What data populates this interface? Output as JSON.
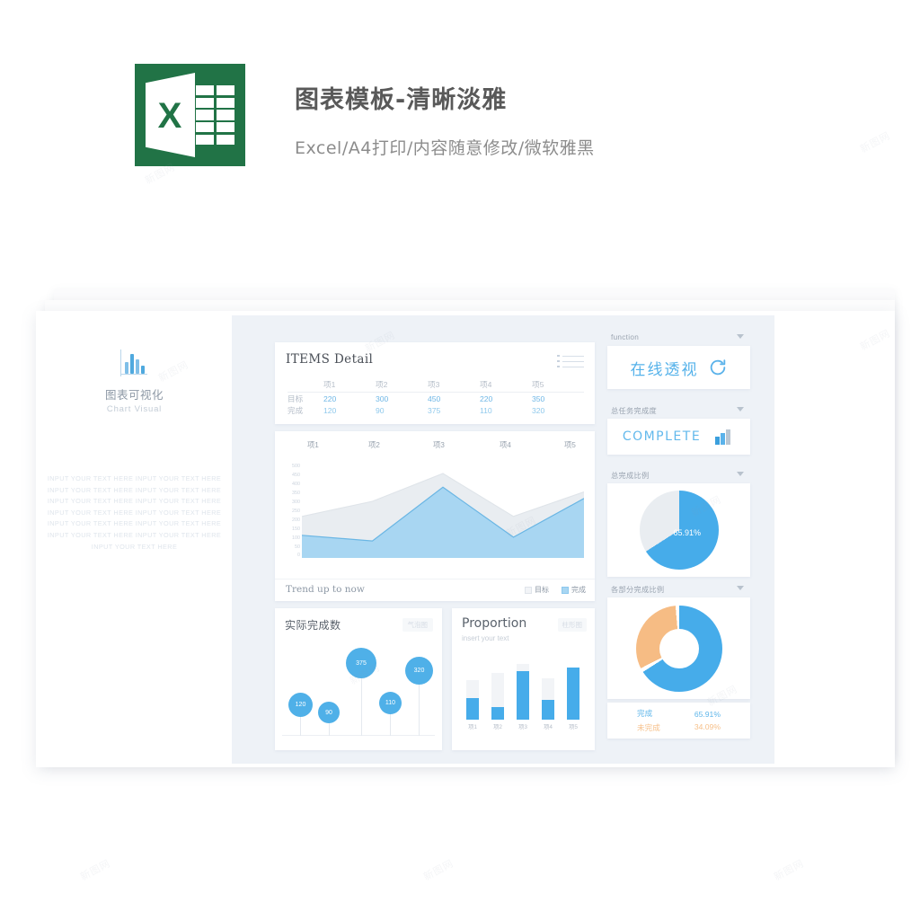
{
  "header": {
    "logo_letter": "X",
    "title": "图表模板-清晰淡雅",
    "subtitle": "Excel/A4打印/内容随意修改/微软雅黑"
  },
  "sidebar_left": {
    "brand_cn": "图表可视化",
    "brand_en": "Chart Visual",
    "filler_text": "INPUT YOUR TEXT HERE INPUT YOUR TEXT HERE INPUT YOUR TEXT HERE INPUT YOUR TEXT HERE INPUT YOUR TEXT HERE INPUT YOUR TEXT HERE INPUT YOUR TEXT HERE INPUT YOUR TEXT HERE INPUT YOUR TEXT HERE INPUT YOUR TEXT HERE INPUT YOUR TEXT HERE INPUT YOUR TEXT HERE INPUT YOUR TEXT HERE"
  },
  "items_detail": {
    "title": "ITEMS Detail",
    "menu_icon": "list-icon",
    "columns": [
      "",
      "项1",
      "项2",
      "项3",
      "项4",
      "项5"
    ],
    "rows": [
      {
        "label": "目标",
        "values": [
          "220",
          "300",
          "450",
          "220",
          "350"
        ]
      },
      {
        "label": "完成",
        "values": [
          "120",
          "90",
          "375",
          "110",
          "320"
        ]
      }
    ]
  },
  "area_chart": {
    "footer_label": "Trend up to now",
    "legend": [
      "目标",
      "完成"
    ],
    "top_labels": [
      "项1",
      "项2",
      "项3",
      "项4",
      "项5"
    ],
    "y_ticks": [
      "500",
      "450",
      "400",
      "350",
      "300",
      "250",
      "200",
      "150",
      "100",
      "50",
      "0"
    ]
  },
  "bubble_chart": {
    "title": "实际完成数",
    "badge": "气泡图",
    "values": [
      "120",
      "90",
      "375",
      "110",
      "320"
    ]
  },
  "proportion": {
    "title": "Proportion",
    "subtitle": "insert your text",
    "badge": "柱形图",
    "categories": [
      "项1",
      "项2",
      "项3",
      "项4",
      "项5"
    ]
  },
  "sidebar_right": {
    "function_panel": {
      "header": "function",
      "value": "在线透视",
      "icon": "refresh-icon"
    },
    "complete_panel": {
      "header": "总任务完成度",
      "value": "COMPLETE",
      "icon": "bar-chart-icon"
    },
    "pie_panel": {
      "header": "总完成比例",
      "label": "65.91%"
    },
    "donut_panel": {
      "header": "各部分完成比例",
      "legend": [
        {
          "name": "完成",
          "value": "65.91%"
        },
        {
          "name": "未完成",
          "value": "34.09%"
        }
      ]
    }
  },
  "colors": {
    "excel_green": "#217346",
    "accent_blue": "#46acea",
    "light_blue": "#a8d6f2",
    "orange": "#f6bc84",
    "panel_bg": "#eef2f7",
    "grey_fill": "#e9edf1"
  },
  "watermark": "新图网",
  "chart_data": [
    {
      "type": "area",
      "title": "Trend up to now",
      "categories": [
        "项1",
        "项2",
        "项3",
        "项4",
        "项5"
      ],
      "series": [
        {
          "name": "目标",
          "values": [
            220,
            300,
            450,
            220,
            350
          ]
        },
        {
          "name": "完成",
          "values": [
            120,
            90,
            375,
            110,
            320
          ]
        }
      ],
      "ylim": [
        0,
        500
      ],
      "grid": false,
      "legend_position": "bottom-right"
    },
    {
      "type": "scatter",
      "title": "实际完成数",
      "categories": [
        "项1",
        "项2",
        "项3",
        "项4",
        "项5"
      ],
      "values": [
        120,
        90,
        375,
        110,
        320
      ],
      "ylim": [
        0,
        450
      ],
      "grid": false
    },
    {
      "type": "bar",
      "title": "Proportion",
      "categories": [
        "项1",
        "项2",
        "项3",
        "项4",
        "项5"
      ],
      "values": [
        120,
        90,
        375,
        110,
        320
      ],
      "target": [
        220,
        300,
        450,
        220,
        350
      ],
      "ylim": [
        0,
        500
      ],
      "grid": false
    },
    {
      "type": "pie",
      "title": "总完成比例",
      "labels": [
        "完成",
        "未完成"
      ],
      "values": [
        65.91,
        34.09
      ],
      "data_labels": [
        "65.91%"
      ]
    },
    {
      "type": "pie",
      "title": "各部分完成比例",
      "labels": [
        "完成",
        "未完成"
      ],
      "values": [
        65.91,
        34.09
      ],
      "donut": true
    }
  ]
}
